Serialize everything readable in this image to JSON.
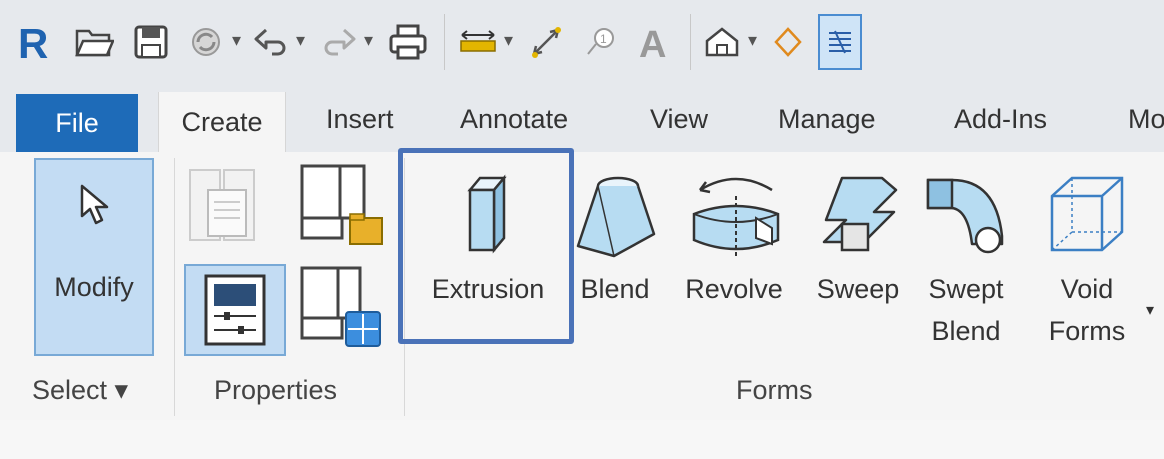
{
  "qat": {
    "items": [
      {
        "name": "revit-logo-icon"
      },
      {
        "name": "open-icon"
      },
      {
        "name": "save-icon"
      },
      {
        "name": "sync-icon"
      },
      {
        "name": "undo-icon"
      },
      {
        "name": "redo-icon"
      },
      {
        "name": "print-icon"
      },
      {
        "name": "measure-icon"
      },
      {
        "name": "aligned-dimension-icon"
      },
      {
        "name": "tag-icon"
      },
      {
        "name": "text-icon"
      },
      {
        "name": "default-3d-view-icon"
      },
      {
        "name": "section-icon"
      },
      {
        "name": "thin-lines-icon"
      }
    ],
    "colors": {
      "revit_blue": "#1f63b0",
      "print_bar": "#e3b500"
    }
  },
  "tabs": {
    "file": "File",
    "create": "Create",
    "insert": "Insert",
    "annotate": "Annotate",
    "view": "View",
    "manage": "Manage",
    "addins": "Add-Ins",
    "more": "Mo"
  },
  "ribbon": {
    "modify": {
      "label": "Modify",
      "icon": "cursor-arrow-icon"
    },
    "select_panel": {
      "label": "Select ▾"
    },
    "properties_panel": {
      "label": "Properties",
      "tools": [
        "family-category-icon",
        "family-types-icon",
        "properties-icon",
        "shared-parameters-icon"
      ]
    },
    "forms_panel": {
      "label": "Forms",
      "tools": [
        {
          "label": "Extrusion",
          "icon": "extrusion-icon"
        },
        {
          "label": "Blend",
          "icon": "blend-icon"
        },
        {
          "label": "Revolve",
          "icon": "revolve-icon"
        },
        {
          "label": "Sweep",
          "icon": "sweep-icon"
        },
        {
          "label": "Swept\nBlend",
          "icon": "swept-blend-icon"
        },
        {
          "label": "Void\nForms",
          "icon": "void-forms-icon"
        }
      ]
    },
    "highlight_color": "#4a72b8",
    "accent": "#1e6bb8"
  }
}
